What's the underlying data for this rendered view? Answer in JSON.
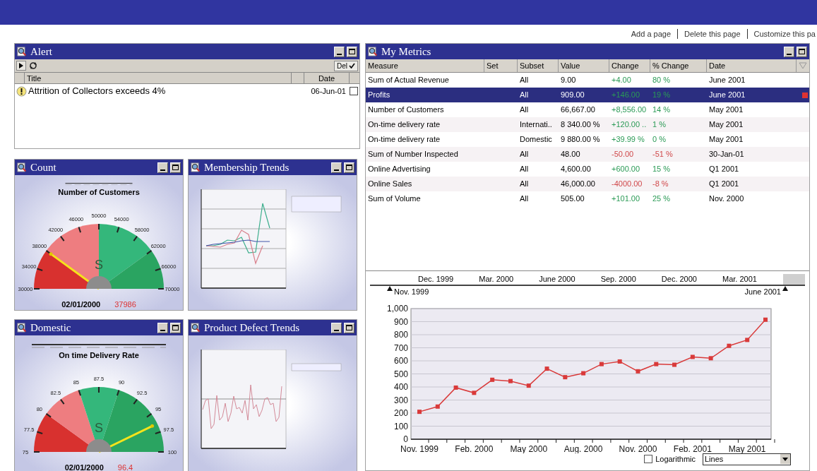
{
  "top_links": [
    "Add a page",
    "Delete this page",
    "Customize this pa"
  ],
  "alert": {
    "title": "Alert",
    "toolbar": {
      "delete_label": "Del"
    },
    "columns": [
      "Title",
      "Date"
    ],
    "rows": [
      {
        "title": "Attrition of Collectors exceeds 4%",
        "date": "06-Jun-01",
        "checked": false
      }
    ]
  },
  "gauges": [
    {
      "panel_title": "Count",
      "title": "Number of Customers",
      "scale_labels": [
        "30000",
        "34000",
        "38000",
        "42000",
        "46000",
        "50000",
        "54000",
        "58000",
        "62000",
        "66000",
        "70000"
      ],
      "symbol": "S",
      "date": "02/01/2000",
      "reading": "37986",
      "level": 0.2
    },
    {
      "panel_title": "Domestic",
      "title": "On time Delivery Rate",
      "scale_labels": [
        "75",
        "77.5",
        "80",
        "82.5",
        "85",
        "87.5",
        "90",
        "92.5",
        "95",
        "97.5",
        "100"
      ],
      "symbol": "S",
      "date": "02/01/2000",
      "reading": "96.4",
      "level": 0.856
    }
  ],
  "trends": [
    {
      "panel_title": "Membership Trends",
      "kind": "multi"
    },
    {
      "panel_title": "Product Defect Trends",
      "kind": "single"
    }
  ],
  "metrics": {
    "title": "My Metrics",
    "columns": [
      "Measure",
      "Set",
      "Subset",
      "Value",
      "Change",
      "% Change",
      "Date"
    ],
    "rows": [
      {
        "measure": "Sum of Actual Revenue",
        "subset": "All",
        "value": "9.00",
        "change": "+4.00",
        "pct": "80 %",
        "date": "June 2001",
        "kind": "gain",
        "selected": false
      },
      {
        "measure": "Profits",
        "subset": "All",
        "value": "909.00",
        "change": "+146.00",
        "pct": "19 %",
        "date": "June 2001",
        "kind": "gain",
        "selected": true
      },
      {
        "measure": "Number of Customers",
        "subset": "All",
        "value": "66,667.00",
        "change": "+8,556.00",
        "pct": "14 %",
        "date": "May 2001",
        "kind": "gain",
        "selected": false
      },
      {
        "measure": "On-time delivery rate",
        "subset": "Internati..",
        "value": "8 340.00 %",
        "change": "+120.00 ..",
        "pct": "1 %",
        "date": "May 2001",
        "kind": "gain",
        "selected": false
      },
      {
        "measure": "On-time delivery rate",
        "subset": "Domestic",
        "value": "9 880.00 %",
        "change": "+39.99 %",
        "pct": "0 %",
        "date": "May 2001",
        "kind": "gain",
        "selected": false
      },
      {
        "measure": "Sum of Number Inspected",
        "subset": "All",
        "value": "48.00",
        "change": "-50.00",
        "pct": "-51 %",
        "date": "30-Jan-01",
        "kind": "loss",
        "selected": false
      },
      {
        "measure": "Online Advertising",
        "subset": "All",
        "value": "4,600.00",
        "change": "+600.00",
        "pct": "15 %",
        "date": "Q1 2001",
        "kind": "gain",
        "selected": false
      },
      {
        "measure": "Online Sales",
        "subset": "All",
        "value": "46,000.00",
        "change": "-4000.00",
        "pct": "-8 %",
        "date": "Q1 2001",
        "kind": "loss",
        "selected": false
      },
      {
        "measure": "Sum of Volume",
        "subset": "All",
        "value": "505.00",
        "change": "+101.00",
        "pct": "25 %",
        "date": "Nov. 2000",
        "kind": "gain",
        "selected": false
      }
    ],
    "timeline": {
      "labels": [
        "Dec. 1999",
        "Mar. 2000",
        "June 2000",
        "Sep. 2000",
        "Dec. 2000",
        "Mar. 2001"
      ],
      "start": "Nov. 1999",
      "end": "June 2001",
      "level": 0.95
    },
    "chart_data": {
      "type": "line",
      "categories": [
        "Nov. 1999",
        null,
        null,
        "Feb. 2000",
        null,
        null,
        "May 2000",
        null,
        null,
        "Aug. 2000",
        null,
        null,
        "Nov. 2000",
        null,
        null,
        "Feb. 2001",
        null,
        null,
        "May 2001",
        null
      ],
      "grid": true,
      "series": [
        {
          "color": "#d93a3a",
          "marker": "square",
          "values": [
            210,
            250,
            395,
            355,
            455,
            445,
            410,
            540,
            475,
            505,
            575,
            595,
            520,
            575,
            570,
            630,
            620,
            715,
            760,
            915
          ]
        }
      ],
      "ylim": [
        0,
        1000
      ],
      "yticks": [
        {
          "value": 0,
          "label": "0"
        },
        {
          "value": 100,
          "label": "100"
        },
        {
          "value": 200,
          "label": "200"
        },
        {
          "value": 300,
          "label": "300"
        },
        {
          "value": 400,
          "label": "400"
        },
        {
          "value": 500,
          "label": "500"
        },
        {
          "value": 600,
          "label": "600"
        },
        {
          "value": 700,
          "label": "700"
        },
        {
          "value": 800,
          "label": "800"
        },
        {
          "value": 900,
          "label": "900"
        },
        {
          "value": 1000,
          "label": "1,000"
        }
      ]
    },
    "logarithmic": {
      "label": "Logarithmic",
      "checked": false
    },
    "chart_type": {
      "value": "Lines"
    }
  }
}
